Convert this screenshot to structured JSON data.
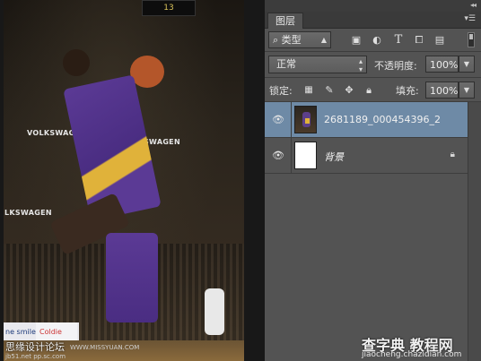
{
  "canvas": {
    "scoreboard": "13",
    "banners": [
      "VOLKSWAGEN",
      "SWAGEN",
      "LKSWAGEN"
    ],
    "ad_text": [
      "ne smiles",
      "Coldie"
    ],
    "watermark_cn": "思缘设计论坛",
    "watermark_url": "WWW.MISSYUAN.COM",
    "watermark_small": "jb51.net  pp.sc.com"
  },
  "panel": {
    "tab_label": "图层",
    "filter_kind": "类型",
    "blend_mode": "正常",
    "opacity_label": "不透明度:",
    "opacity_value": "100%",
    "lock_label": "锁定:",
    "fill_label": "填充:",
    "fill_value": "100%",
    "layers": [
      {
        "name": "2681189_000454396_2",
        "selected": true
      },
      {
        "name": "背景",
        "locked": true
      }
    ],
    "icons": {
      "collapse": "double-arrow-icon",
      "menu": "panel-menu-icon",
      "search": "search-icon",
      "filter_icons": [
        "image-filter-icon",
        "adjustment-filter-icon",
        "type-filter-icon",
        "shape-filter-icon",
        "smart-object-filter-icon"
      ],
      "lock_icons": [
        "lock-transparent-icon",
        "lock-image-icon",
        "lock-position-icon",
        "lock-all-icon"
      ]
    }
  },
  "site_watermark": {
    "cn": "查字典 教程网",
    "url": "jiaocheng.chazidian.com"
  }
}
